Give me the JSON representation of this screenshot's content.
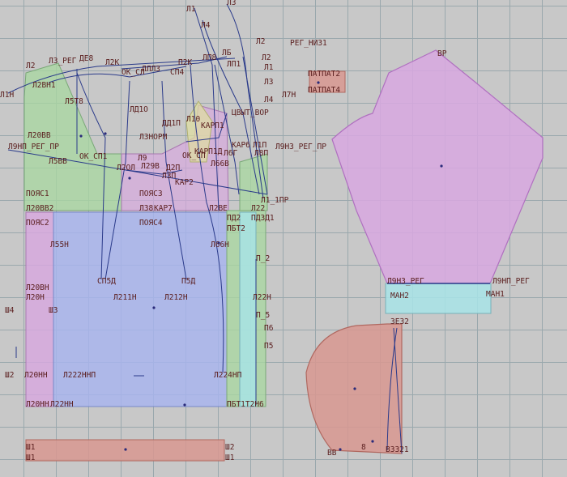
{
  "colors": {
    "grid": "#9aa8ad",
    "background": "#c8c8c8",
    "label": "#5a1e1e",
    "piece_green": "#a8d8a0",
    "piece_blue": "#a8b4f0",
    "piece_pink": "#d8a8e0",
    "piece_red": "#d89890",
    "piece_cyan": "#a8e4e8",
    "seam_line": "#2a3a8a"
  },
  "pieces": {
    "front_bodice": "front-bodice",
    "back_bodice": "back-bodice",
    "skirt_front": "skirt-front",
    "side_strip": "side-strip",
    "sleeve": "sleeve",
    "cuff": "cuff",
    "collar": "collar",
    "waistband": "waistband"
  },
  "labels": [
    "Л1",
    "Л4",
    "Л2",
    "ГРЕГ_НИЗ1",
    "ЛПАТ2",
    "ЛПАТ4",
    "Л2",
    "Л3",
    "ГЛ2",
    "ЛПЕ8",
    "ЛДЕ8",
    "Л12К",
    "ЛКИ",
    "ЛЛ4",
    "ЛСП4",
    "ЛП2К",
    "ЛГЛП",
    "ЛЦЛ2",
    "ЛЛЛЛ3",
    "Л7Н",
    "Л4",
    "Л1Н",
    "Л5Т8",
    "ЛД1О",
    "ЛВЫТ_ВОР",
    "Л10",
    "ЛЗ0ВВ",
    "Л3НОРМ",
    "ЛД1П",
    "КАРП1",
    "Л9НП_РЕГ_ПР",
    "ЛЗ0ВВ",
    "ЛОК_СП1",
    "Л9",
    "ЛКА1П",
    "ЛК6",
    "Л3НЗ_РЕГ_ПР",
    "Л5ВВ",
    "Л24",
    "Л29В",
    "Л2ОЛ",
    "Л66В",
    "ЛКАР2",
    "ЛПОЯС1",
    "ЛПОЯС3",
    "Л1_1ПР",
    "Л20ВВ",
    "Л38",
    "ЛКАР7",
    "Л22",
    "ЛПОЯС2",
    "ЛПОЯС4",
    "ЛД2",
    "ЛЛД1",
    "Л55Н",
    "ЛБТ2",
    "Л66Н",
    "ЛП_2",
    "ЛП5Д",
    "Л5Д",
    "Л20ВН",
    "Л20Н",
    "Л211Н",
    "Л212Н",
    "Л22Н",
    "ЛШЛ4",
    "ЛШЛ3",
    "ЛП_5",
    "ЛП6",
    "ЛП5",
    "ЛШЛ2",
    "Л20НП",
    "Л222ННП",
    "Л224НП",
    "Л20НН",
    "Л22НН",
    "ЛБТ2Н6",
    "Л3НЗ_РЕГ",
    "Л9НП_РЕГ",
    "МАН2",
    "МАН1",
    "ЛВР",
    "ЛЗ2",
    "ЛШ1",
    "ЛШ2",
    "Л1",
    "Л2",
    "ЛВ8",
    "Л8",
    "Л3",
    "ЛЗ1"
  ]
}
